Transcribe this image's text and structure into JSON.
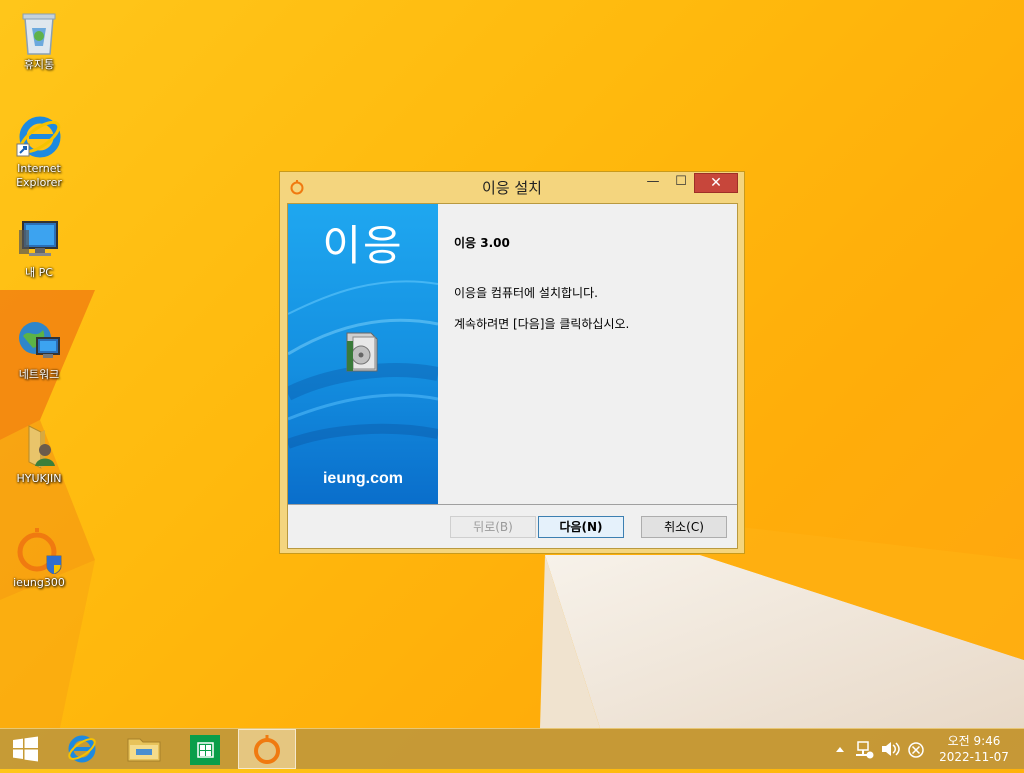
{
  "desktop": {
    "icons": [
      {
        "label": "휴지통",
        "icon": "recycle-bin-icon"
      },
      {
        "label": "Internet Explorer",
        "icon": "internet-explorer-icon"
      },
      {
        "label": "내 PC",
        "icon": "computer-icon"
      },
      {
        "label": "네트워크",
        "icon": "network-icon"
      },
      {
        "label": "HYUKJIN",
        "icon": "user-folder-icon"
      },
      {
        "label": "ieung300",
        "icon": "ieung-setup-icon"
      }
    ]
  },
  "window": {
    "title": "이응 설치",
    "minimize": "—",
    "maximize": "☐",
    "close": "✕",
    "banner": {
      "title": "이응",
      "url": "ieung.com"
    },
    "heading": "이응 3.00",
    "line1": "이응을 컴퓨터에 설치합니다.",
    "line2": "계속하려면 [다음]을 클릭하십시오.",
    "buttons": {
      "back": "뒤로(B)",
      "next": "다음(N)",
      "cancel": "취소(C)"
    }
  },
  "taskbar": {
    "items": [
      "start-button",
      "internet-explorer",
      "file-explorer",
      "store",
      "ieung-installer"
    ],
    "clock": {
      "time": "오전 9:46",
      "date": "2022-11-07"
    }
  },
  "colors": {
    "wallpaper": "#ffb90d",
    "close_button": "#c7463b",
    "banner_blue": "#148fe0"
  }
}
